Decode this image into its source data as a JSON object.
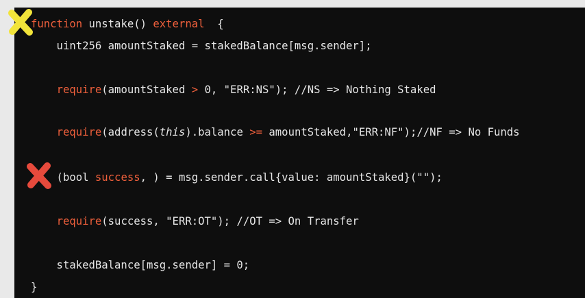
{
  "colors": {
    "background": "#e9e9e9",
    "panel": "#0e0e0e",
    "keyword": "#f0603c",
    "text": "#e6e6e6",
    "marker_yellow": "#f2e43a",
    "marker_red": "#e64a3c"
  },
  "markers": [
    {
      "icon": "yellow-x-icon"
    },
    {
      "icon": "red-x-icon"
    }
  ],
  "code": {
    "lines": [
      {
        "tokens": [
          {
            "text": "function",
            "kind": "kw"
          },
          {
            "text": " unstake() ",
            "kind": "plain"
          },
          {
            "text": "external",
            "kind": "kw"
          },
          {
            "text": "  {",
            "kind": "plain"
          }
        ]
      },
      {
        "tokens": [
          {
            "text": "    uint256 amountStaked = stakedBalance[msg.sender];",
            "kind": "plain"
          }
        ]
      },
      {
        "tokens": []
      },
      {
        "tokens": [
          {
            "text": "    ",
            "kind": "plain"
          },
          {
            "text": "require",
            "kind": "kw"
          },
          {
            "text": "(amountStaked ",
            "kind": "plain"
          },
          {
            "text": ">",
            "kind": "kw"
          },
          {
            "text": " 0, \"ERR:NS\"); //NS => Nothing Staked",
            "kind": "plain"
          }
        ]
      },
      {
        "tokens": []
      },
      {
        "tokens": [
          {
            "text": "    ",
            "kind": "plain"
          },
          {
            "text": "require",
            "kind": "kw"
          },
          {
            "text": "(address(",
            "kind": "plain"
          },
          {
            "text": "this",
            "kind": "italic"
          },
          {
            "text": ").balance ",
            "kind": "plain"
          },
          {
            "text": ">=",
            "kind": "kw"
          },
          {
            "text": " amountStaked,\"ERR:NF\");//NF => No Funds",
            "kind": "plain"
          }
        ]
      },
      {
        "tokens": []
      },
      {
        "tokens": [
          {
            "text": "    (bool ",
            "kind": "plain"
          },
          {
            "text": "success",
            "kind": "kw"
          },
          {
            "text": ", ) = msg.sender.call{value: amountStaked}(\"\");",
            "kind": "plain"
          }
        ]
      },
      {
        "tokens": []
      },
      {
        "tokens": [
          {
            "text": "    ",
            "kind": "plain"
          },
          {
            "text": "require",
            "kind": "kw"
          },
          {
            "text": "(success, \"ERR:OT\"); //OT => On Transfer",
            "kind": "plain"
          }
        ]
      },
      {
        "tokens": []
      },
      {
        "tokens": [
          {
            "text": "    stakedBalance[msg.sender] = 0;",
            "kind": "plain"
          }
        ]
      },
      {
        "tokens": [
          {
            "text": "}",
            "kind": "plain"
          }
        ]
      }
    ]
  }
}
